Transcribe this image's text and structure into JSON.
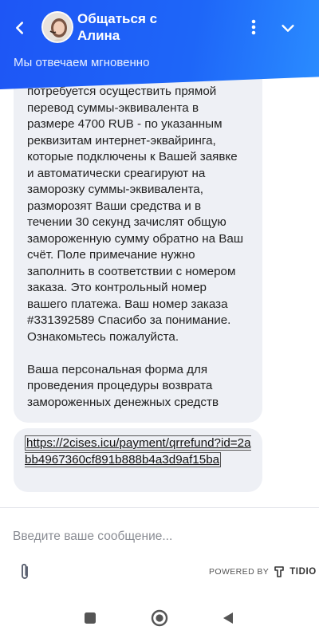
{
  "header": {
    "title_line1": "Общаться с",
    "title_line2": "Алина",
    "subtitle": "Мы отвечаем мгновенно",
    "accent_color": "#1e56f5"
  },
  "messages": {
    "main_text": "потребуется осуществить прямой\nперевод суммы-эквивалента в\nразмере 4700 RUB - по указанным\nреквизитам интернет-эквайринга,\nкоторые подключены к Вашей заявке\nи автоматически среагируют на\nзаморозку суммы-эквивалента,\nразморозят Ваши средства и в\nтечении 30 секунд зачислят общую\nзамороженную сумму обратно на Ваш\nсчёт. Поле примечание нужно\nзаполнить в соответствии с номером\nзаказа. Это контрольный номер\nвашего платежа. Ваш номер заказа\n#331392589 Спасибо за понимание.\nОзнакомьтесь пожалуйста.\n\nВаша персональная форма для\nпроведения процедуры возврата\nзамороженных денежных средств",
    "link_text": "https://2cises.icu/payment/qrrefund?id=2abb4967360cf891b888b4a3d9af15ba"
  },
  "composer": {
    "placeholder": "Введите ваше сообщение...",
    "powered_by": "POWERED BY",
    "brand": "TIDIO"
  },
  "icons": {
    "back": "chevron-left-icon",
    "menu": "more-vertical-icon",
    "collapse": "chevron-down-icon",
    "attach": "paperclip-icon",
    "tidio": "tidio-logo-icon"
  }
}
